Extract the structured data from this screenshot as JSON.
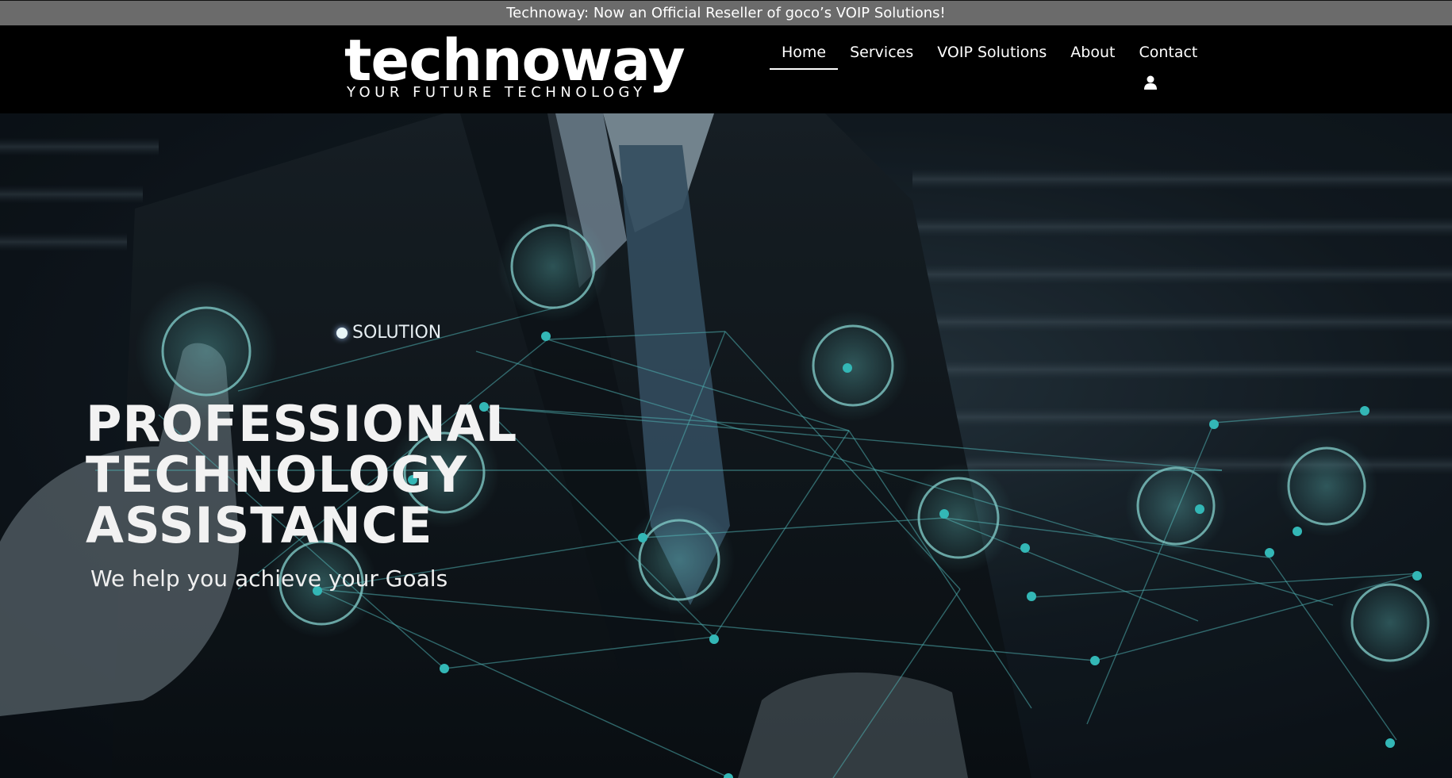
{
  "announcement": {
    "text": "Technoway: Now an Official Reseller of goco’s VOIP Solutions!"
  },
  "header": {
    "logo": {
      "wordmark": "technoway",
      "tagline": "YOUR FUTURE TECHNOLOGY"
    },
    "nav": [
      {
        "label": "Home",
        "active": true
      },
      {
        "label": "Services",
        "active": false
      },
      {
        "label": "VOIP Solutions",
        "active": false
      },
      {
        "label": "About",
        "active": false
      },
      {
        "label": "Contact",
        "active": false
      }
    ],
    "account_icon": "user-icon"
  },
  "hero": {
    "title_lines": [
      "PROFESSIONAL",
      "TECHNOLOGY",
      "ASSISTANCE"
    ],
    "subtitle": "We help you achieve your Goals",
    "image_label": "SOLUTION"
  },
  "colors": {
    "announcement_bg": "#6b6b6b",
    "header_bg": "#000000",
    "accent_cyan": "#35d6d8",
    "text_white": "#ffffff"
  }
}
